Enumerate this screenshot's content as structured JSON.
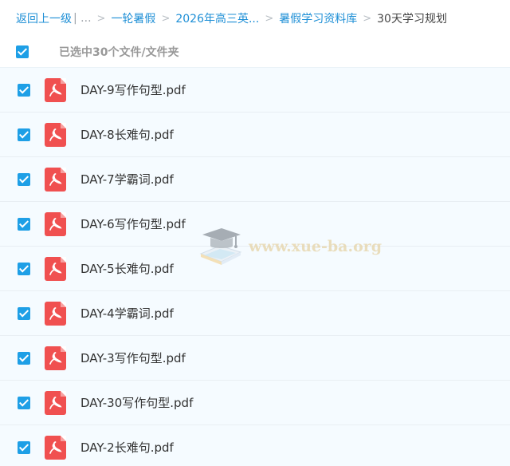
{
  "breadcrumb": {
    "back_label": "返回上一级",
    "more_label": "| ...",
    "separator": ">",
    "items": [
      "一轮暑假",
      "2026年高三英...",
      "暑假学习资料库"
    ],
    "current": "30天学习规划"
  },
  "selection": {
    "count_label": "已选中30个文件/文件夹",
    "all_checked": true
  },
  "files": [
    {
      "name": "DAY-9写作句型.pdf",
      "checked": true
    },
    {
      "name": "DAY-8长难句.pdf",
      "checked": true
    },
    {
      "name": "DAY-7学霸词.pdf",
      "checked": true
    },
    {
      "name": "DAY-6写作句型.pdf",
      "checked": true
    },
    {
      "name": "DAY-5长难句.pdf",
      "checked": true
    },
    {
      "name": "DAY-4学霸词.pdf",
      "checked": true
    },
    {
      "name": "DAY-3写作句型.pdf",
      "checked": true
    },
    {
      "name": "DAY-30写作句型.pdf",
      "checked": true
    },
    {
      "name": "DAY-2长难句.pdf",
      "checked": true
    }
  ],
  "watermark": {
    "text": "www.xue-ba.org",
    "icon": "graduation-cap-book-icon"
  },
  "colors": {
    "link": "#1e8fd6",
    "checkbox": "#1e9fe6",
    "pdf_icon": "#f05050",
    "row_background": "#f5fbff"
  }
}
